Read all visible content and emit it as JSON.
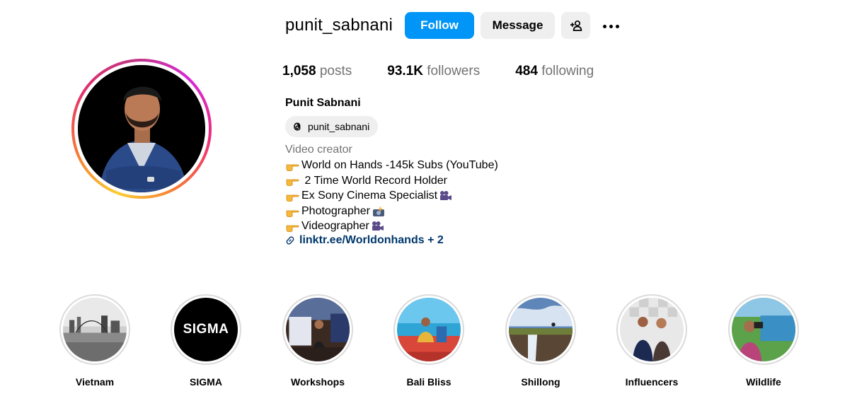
{
  "profile": {
    "username": "punit_sabnani",
    "full_name": "Punit Sabnani",
    "threads_handle": "punit_sabnani",
    "category": "Video creator"
  },
  "actions": {
    "follow": "Follow",
    "message": "Message"
  },
  "stats": {
    "posts_count": "1,058",
    "posts_label": "posts",
    "followers_count": "93.1K",
    "followers_label": "followers",
    "following_count": "484",
    "following_label": "following"
  },
  "bio": {
    "lines": [
      "World on Hands -145k Subs (YouTube)",
      " 2 Time World Record Holder",
      "Ex Sony Cinema Specialist",
      "Photographer",
      "Videographer"
    ],
    "link": "linktr.ee/Worldonhands + 2"
  },
  "highlights": [
    {
      "label": "Vietnam"
    },
    {
      "label": "SIGMA",
      "logo_text": "SIGMA"
    },
    {
      "label": "Workshops"
    },
    {
      "label": "Bali Bliss"
    },
    {
      "label": "Shillong"
    },
    {
      "label": "Influencers"
    },
    {
      "label": "Wildlife"
    }
  ],
  "colors": {
    "accent": "#0095f6",
    "secondary_button": "#efefef",
    "muted_text": "#737373",
    "link": "#00376b"
  },
  "icons": {
    "suggest": "person-plus-icon",
    "more": "more-options-icon",
    "threads": "threads-icon",
    "link": "link-icon",
    "bullet": "pointing-hand-icon"
  }
}
